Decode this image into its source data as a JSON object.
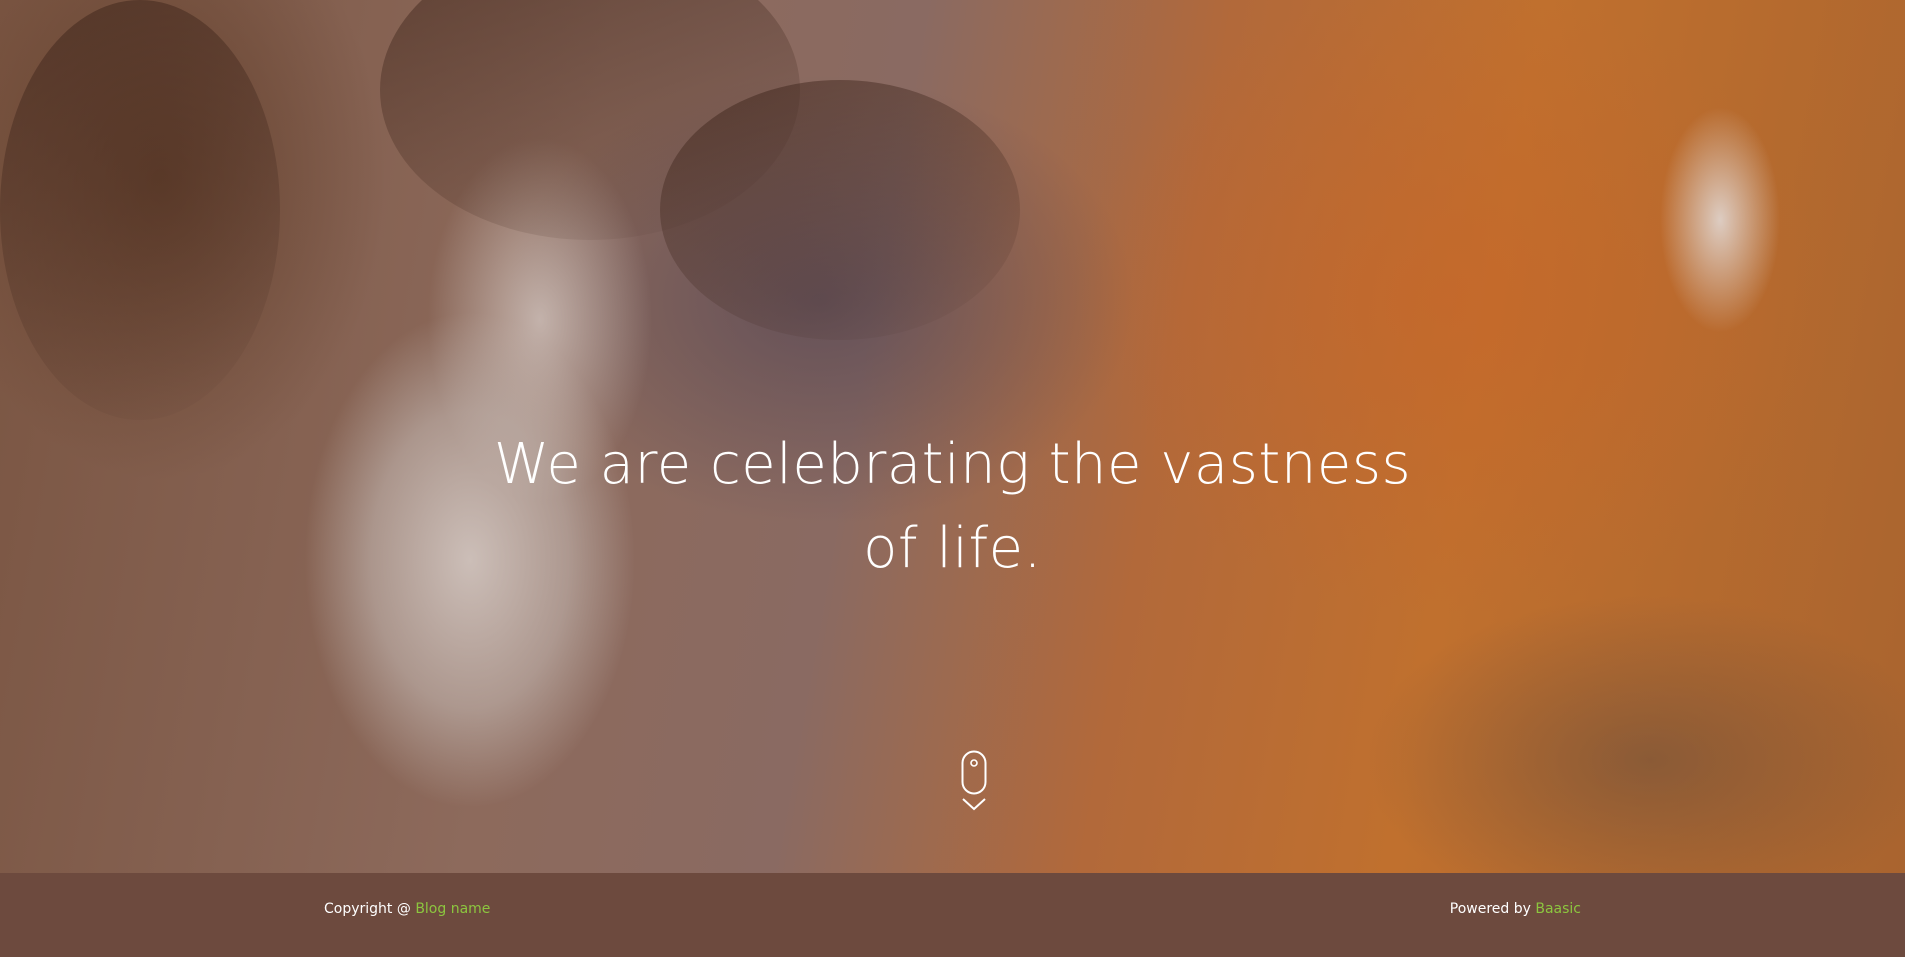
{
  "hero": {
    "headline_line1": "We are celebrating the vastness",
    "headline_line2": "of life.",
    "scroll_icon": "mouse-scroll-down-icon"
  },
  "footer": {
    "copyright_prefix": "Copyright @ ",
    "blog_link": "Blog name",
    "powered_prefix": "Powered by ",
    "powered_link": "Baasic"
  },
  "colors": {
    "footer_background": "#6d4a3e",
    "link_accent": "#8cc63f",
    "text": "#ffffff"
  }
}
